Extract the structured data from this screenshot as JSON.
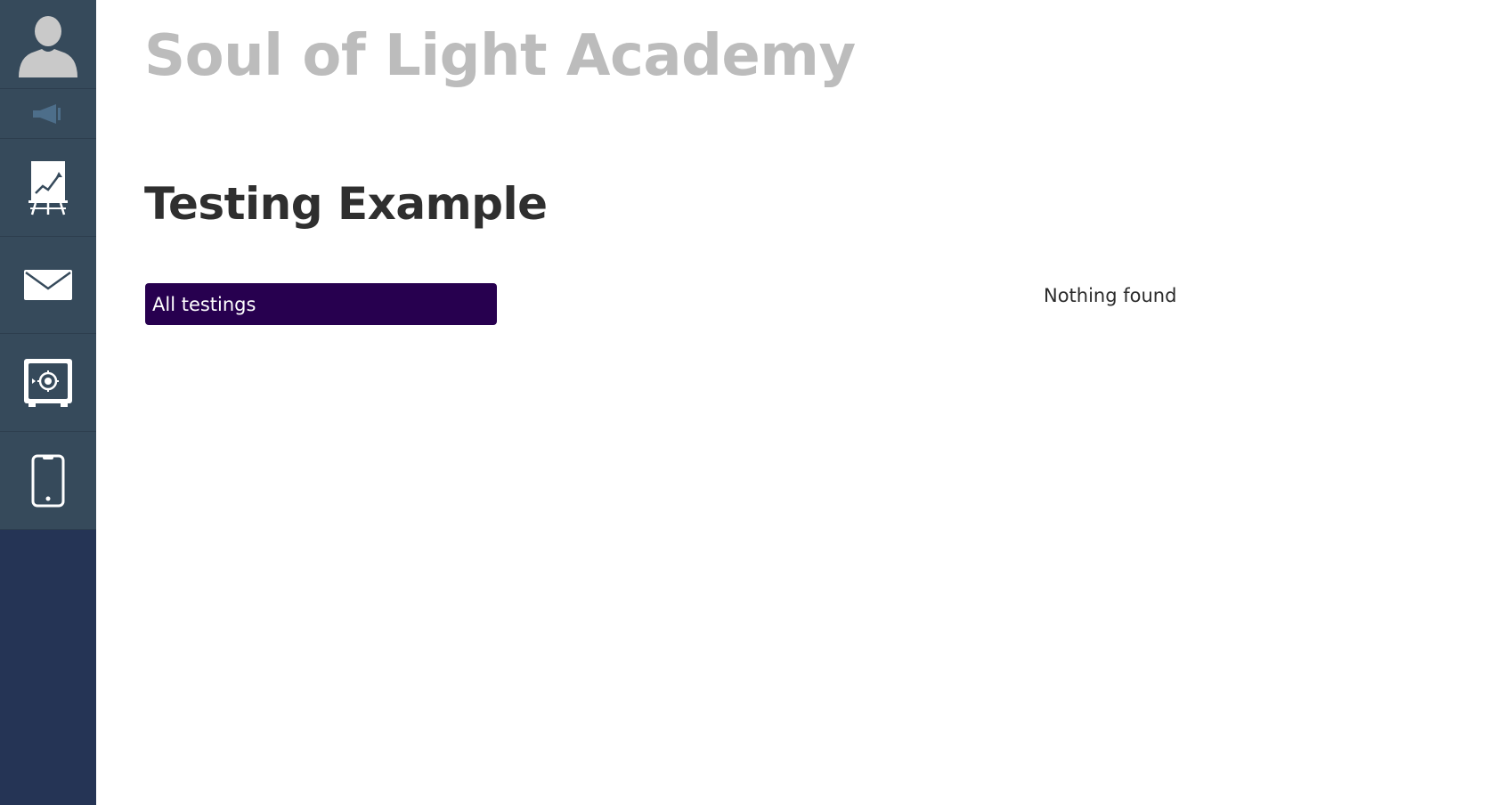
{
  "sidebar": {
    "items": [
      {
        "icon": "user-avatar-icon"
      },
      {
        "icon": "megaphone-icon"
      },
      {
        "icon": "presentation-chart-icon"
      },
      {
        "icon": "mail-icon"
      },
      {
        "icon": "safe-icon"
      },
      {
        "icon": "smartphone-icon"
      }
    ]
  },
  "header": {
    "site_title": "Soul of Light Academy"
  },
  "main": {
    "page_title": "Testing Example",
    "filter_button_label": "All testings",
    "empty_message": "Nothing found"
  },
  "colors": {
    "sidebar_bg": "#253455",
    "sidebar_item_bg": "#364a5b",
    "button_bg": "#27004f",
    "site_title": "#bcbcbc"
  }
}
